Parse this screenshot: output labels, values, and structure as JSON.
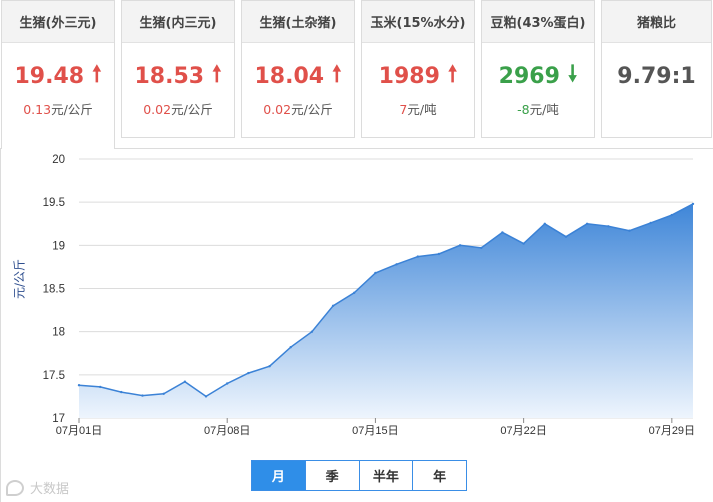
{
  "cards": [
    {
      "title": "生猪(外三元)",
      "value": "19.48",
      "direction": "up",
      "arrow": "🠕",
      "change": "0.13",
      "unit": "元/公斤"
    },
    {
      "title": "生猪(内三元)",
      "value": "18.53",
      "direction": "up",
      "arrow": "🠕",
      "change": "0.02",
      "unit": "元/公斤"
    },
    {
      "title": "生猪(土杂猪)",
      "value": "18.04",
      "direction": "up",
      "arrow": "🠕",
      "change": "0.02",
      "unit": "元/公斤"
    },
    {
      "title": "玉米(15%水分)",
      "value": "1989",
      "direction": "up",
      "arrow": "🠕",
      "change": "7",
      "unit": "元/吨"
    },
    {
      "title": "豆粕(43%蛋白)",
      "value": "2969",
      "direction": "down",
      "arrow": "🠗",
      "change": "-8",
      "unit": "元/吨"
    },
    {
      "title": "猪粮比",
      "value": "9.79:1",
      "direction": "neutral",
      "arrow": "",
      "change": "",
      "unit": ""
    }
  ],
  "chart_data": {
    "type": "area",
    "ylabel": "元/公斤",
    "ylim": [
      17,
      20
    ],
    "yticks": [
      17,
      17.5,
      18,
      18.5,
      19,
      19.5,
      20
    ],
    "xticks": [
      "07月01日",
      "07月08日",
      "07月15日",
      "07月22日",
      "07月29日"
    ],
    "xtick_days": [
      1,
      8,
      15,
      22,
      29
    ],
    "xlim": [
      1,
      30
    ],
    "grid": true,
    "x": [
      1,
      2,
      3,
      4,
      5,
      6,
      7,
      8,
      9,
      10,
      11,
      12,
      13,
      14,
      15,
      16,
      17,
      18,
      19,
      20,
      21,
      22,
      23,
      24,
      25,
      26,
      27,
      28,
      29,
      30
    ],
    "values": [
      17.38,
      17.36,
      17.3,
      17.26,
      17.28,
      17.42,
      17.25,
      17.4,
      17.52,
      17.6,
      17.82,
      18.0,
      18.3,
      18.45,
      18.68,
      18.78,
      18.87,
      18.9,
      19.0,
      18.97,
      19.15,
      19.02,
      19.25,
      19.1,
      19.25,
      19.22,
      19.17,
      19.26,
      19.35,
      19.48
    ],
    "colors": {
      "line": "#3b82d6",
      "fill_top": "#3f86d8",
      "fill_bottom": "#eef5fd",
      "grid": "#dcdcdc",
      "tick_text": "#333333"
    }
  },
  "period_tabs": {
    "items": [
      "月",
      "季",
      "半年",
      "年"
    ],
    "active": 0
  },
  "watermark": "大数据"
}
